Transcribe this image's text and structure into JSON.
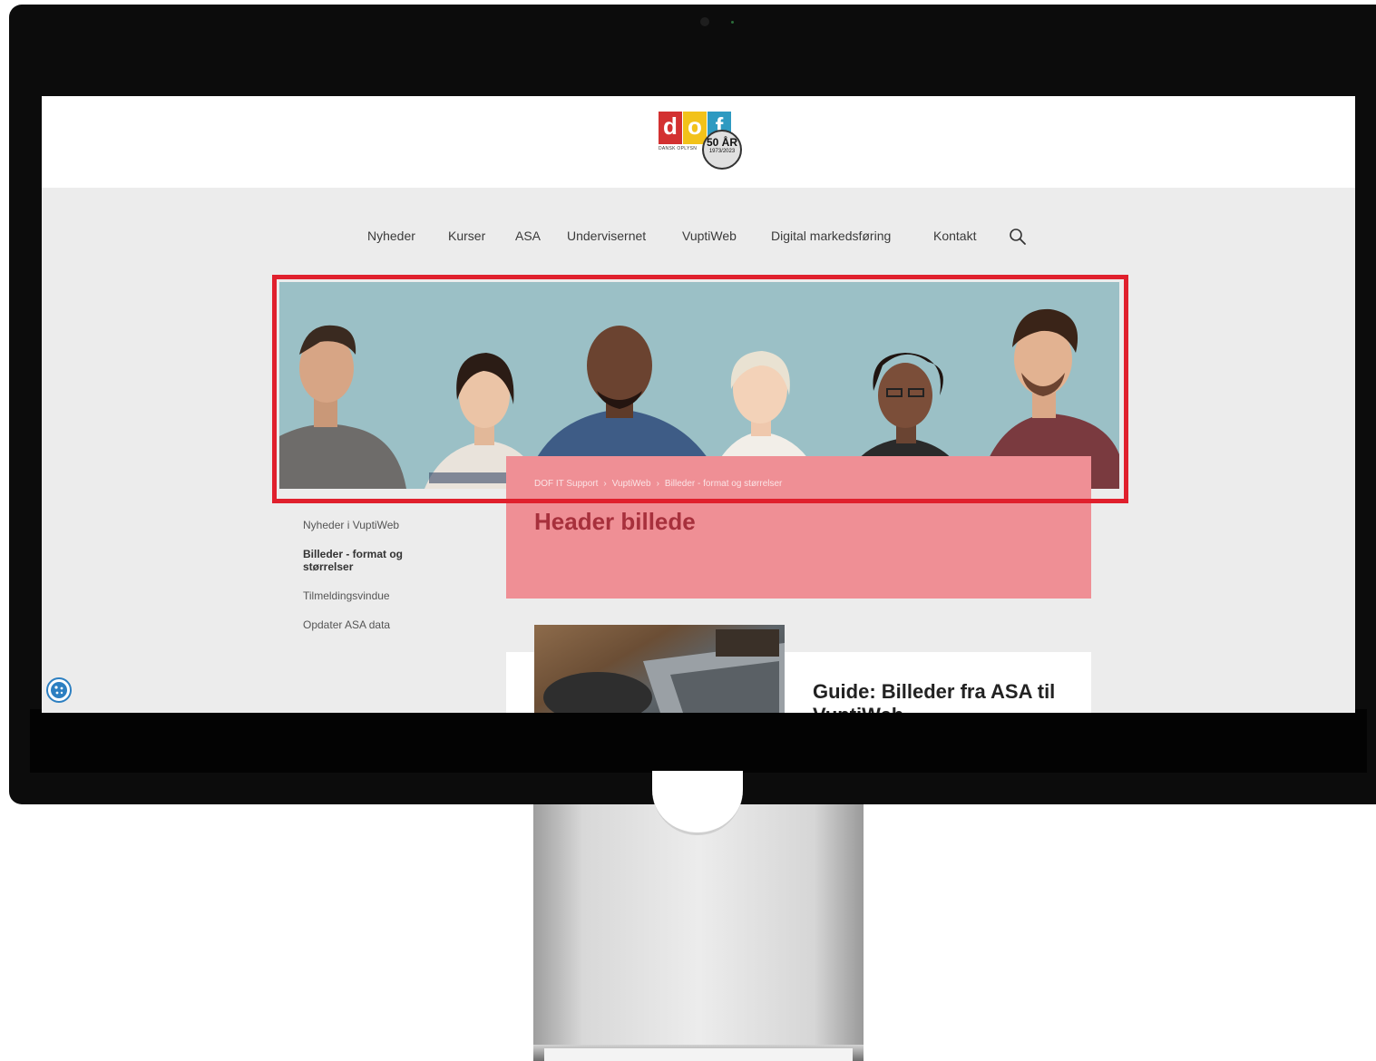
{
  "logo": {
    "letters": [
      "d",
      "o",
      "f"
    ],
    "org_text": "DANSK OPLYSN",
    "badge_main": "50 ÅR",
    "badge_sub": "1973/2023"
  },
  "nav": {
    "items": [
      "Nyheder",
      "Kurser",
      "ASA",
      "Undervisernet",
      "VuptiWeb",
      "Digital markedsføring",
      "Kontakt"
    ],
    "search_icon": "search-icon"
  },
  "breadcrumb": [
    "DOF IT Support",
    "VuptiWeb",
    "Billeder - format og størrelser"
  ],
  "page_title": "Header billede",
  "sidebar": {
    "items": [
      {
        "label": "Nyheder i VuptiWeb"
      },
      {
        "label": "Billeder - format og størrelser"
      },
      {
        "label": "Tilmeldingsvindue"
      },
      {
        "label": "Opdater ASA data"
      }
    ]
  },
  "card": {
    "title": "Guide: Billeder fra ASA til VuptiWeb"
  },
  "colors": {
    "highlight": "#e0202d",
    "title_panel": "#ef8f95",
    "title_text": "#a7303c",
    "hero_bg": "#9bc0c6"
  }
}
